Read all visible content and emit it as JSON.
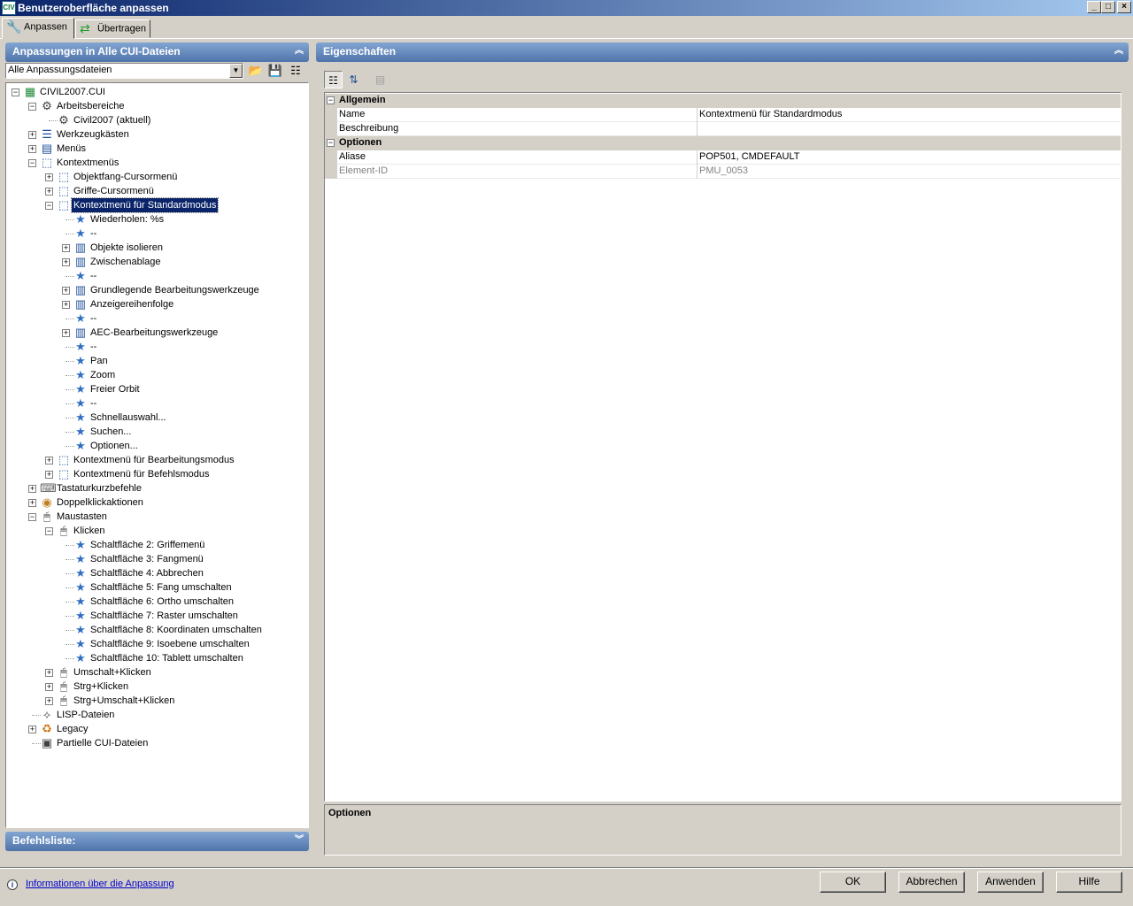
{
  "window": {
    "title": "Benutzeroberfläche anpassen",
    "app_icon_text": "CIV",
    "buttons": {
      "minimize": "_",
      "maximize": "□",
      "close": "×"
    }
  },
  "tabs": [
    {
      "label": "Anpassen",
      "icon": "wrench-icon",
      "active": true
    },
    {
      "label": "Übertragen",
      "icon": "transfer-arrows-icon",
      "active": false
    }
  ],
  "left_panel": {
    "title": "Anpassungen in Alle CUI-Dateien",
    "dropdown_value": "Alle Anpassungsdateien",
    "tree": [
      {
        "label": "CIVIL2007.CUI",
        "icon": "cui-file-icon",
        "expander": "−"
      },
      {
        "label": "Arbeitsbereiche",
        "icon": "workspace-gear-icon",
        "expander": "−"
      },
      {
        "label": "Civil2007 (aktuell)",
        "icon": "gear-icon",
        "expander": ""
      },
      {
        "label": "Werkzeugkästen",
        "icon": "toolbar-icon",
        "expander": "+"
      },
      {
        "label": "Menüs",
        "icon": "menu-icon",
        "expander": "+"
      },
      {
        "label": "Kontextmenüs",
        "icon": "context-menu-icon",
        "expander": "−"
      },
      {
        "label": "Objektfang-Cursormenü",
        "icon": "context-menu-icon",
        "expander": "+"
      },
      {
        "label": "Griffe-Cursormenü",
        "icon": "context-menu-icon",
        "expander": "+"
      },
      {
        "label": "Kontextmenü für Standardmodus",
        "icon": "context-menu-icon",
        "expander": "−",
        "selected": true
      },
      {
        "label": "Wiederholen: %s",
        "icon": "star-icon",
        "expander": ""
      },
      {
        "label": "--",
        "icon": "star-icon",
        "expander": ""
      },
      {
        "label": "Objekte isolieren",
        "icon": "submenu-icon",
        "expander": "+"
      },
      {
        "label": "Zwischenablage",
        "icon": "submenu-icon",
        "expander": "+"
      },
      {
        "label": "--",
        "icon": "star-icon",
        "expander": ""
      },
      {
        "label": "Grundlegende Bearbeitungswerkzeuge",
        "icon": "submenu-icon",
        "expander": "+"
      },
      {
        "label": "Anzeigereihenfolge",
        "icon": "submenu-icon",
        "expander": "+"
      },
      {
        "label": "--",
        "icon": "star-icon",
        "expander": ""
      },
      {
        "label": "AEC-Bearbeitungswerkzeuge",
        "icon": "submenu-icon",
        "expander": "+"
      },
      {
        "label": "--",
        "icon": "star-icon",
        "expander": ""
      },
      {
        "label": "Pan",
        "icon": "star-icon",
        "expander": ""
      },
      {
        "label": "Zoom",
        "icon": "star-icon",
        "expander": ""
      },
      {
        "label": "Freier Orbit",
        "icon": "star-icon",
        "expander": ""
      },
      {
        "label": "--",
        "icon": "star-icon",
        "expander": ""
      },
      {
        "label": "Schnellauswahl...",
        "icon": "star-icon",
        "expander": ""
      },
      {
        "label": "Suchen...",
        "icon": "star-icon",
        "expander": ""
      },
      {
        "label": "Optionen...",
        "icon": "star-icon",
        "expander": ""
      },
      {
        "label": "Kontextmenü für Bearbeitungsmodus",
        "icon": "context-menu-icon",
        "expander": "+"
      },
      {
        "label": "Kontextmenü für Befehlsmodus",
        "icon": "context-menu-icon",
        "expander": "+"
      },
      {
        "label": "Tastaturkurzbefehle",
        "icon": "keyboard-icon",
        "expander": "+"
      },
      {
        "label": "Doppelklickaktionen",
        "icon": "double-click-icon",
        "expander": "+"
      },
      {
        "label": "Maustasten",
        "icon": "mouse-icon",
        "expander": "−"
      },
      {
        "label": "Klicken",
        "icon": "mouse-icon",
        "expander": "−"
      },
      {
        "label": "Schaltfläche 2: Griffemenü",
        "icon": "star-icon",
        "expander": ""
      },
      {
        "label": "Schaltfläche 3: Fangmenü",
        "icon": "star-icon",
        "expander": ""
      },
      {
        "label": "Schaltfläche 4: Abbrechen",
        "icon": "star-icon",
        "expander": ""
      },
      {
        "label": "Schaltfläche 5: Fang umschalten",
        "icon": "star-icon",
        "expander": ""
      },
      {
        "label": "Schaltfläche 6: Ortho umschalten",
        "icon": "star-icon",
        "expander": ""
      },
      {
        "label": "Schaltfläche 7: Raster umschalten",
        "icon": "star-icon",
        "expander": ""
      },
      {
        "label": "Schaltfläche 8: Koordinaten umschalten",
        "icon": "star-icon",
        "expander": ""
      },
      {
        "label": "Schaltfläche 9: Isoebene umschalten",
        "icon": "star-icon",
        "expander": ""
      },
      {
        "label": "Schaltfläche 10: Tablett umschalten",
        "icon": "star-icon",
        "expander": ""
      },
      {
        "label": "Umschalt+Klicken",
        "icon": "mouse-icon",
        "expander": "+"
      },
      {
        "label": "Strg+Klicken",
        "icon": "mouse-icon",
        "expander": "+"
      },
      {
        "label": "Strg+Umschalt+Klicken",
        "icon": "mouse-icon",
        "expander": "+"
      },
      {
        "label": "LISP-Dateien",
        "icon": "lisp-icon",
        "expander": ""
      },
      {
        "label": "Legacy",
        "icon": "legacy-icon",
        "expander": "+"
      },
      {
        "label": "Partielle CUI-Dateien",
        "icon": "partial-cui-icon",
        "expander": ""
      }
    ]
  },
  "command_list": {
    "title": "Befehlsliste:"
  },
  "properties": {
    "title": "Eigenschaften",
    "rows": [
      {
        "type": "category",
        "label": "Allgemein",
        "expander": "−"
      },
      {
        "type": "prop",
        "name": "Name",
        "value": "Kontextmenü für Standardmodus"
      },
      {
        "type": "prop",
        "name": "Beschreibung",
        "value": ""
      },
      {
        "type": "category",
        "label": "Optionen",
        "expander": "−"
      },
      {
        "type": "prop",
        "name": "Aliase",
        "value": "POP501, CMDEFAULT"
      },
      {
        "type": "prop",
        "name": "Element-ID",
        "value": "PMU_0053",
        "disabled": true
      }
    ],
    "description_title": "Optionen"
  },
  "footer": {
    "info_link": "Informationen über die Anpassung",
    "buttons": {
      "ok": "OK",
      "cancel": "Abbrechen",
      "apply": "Anwenden",
      "help": "Hilfe"
    }
  },
  "colors": {
    "selection": "#0a246a",
    "header_top": "#82a5d2",
    "header_bottom": "#4f74aa",
    "star": "#2f6fc2"
  }
}
